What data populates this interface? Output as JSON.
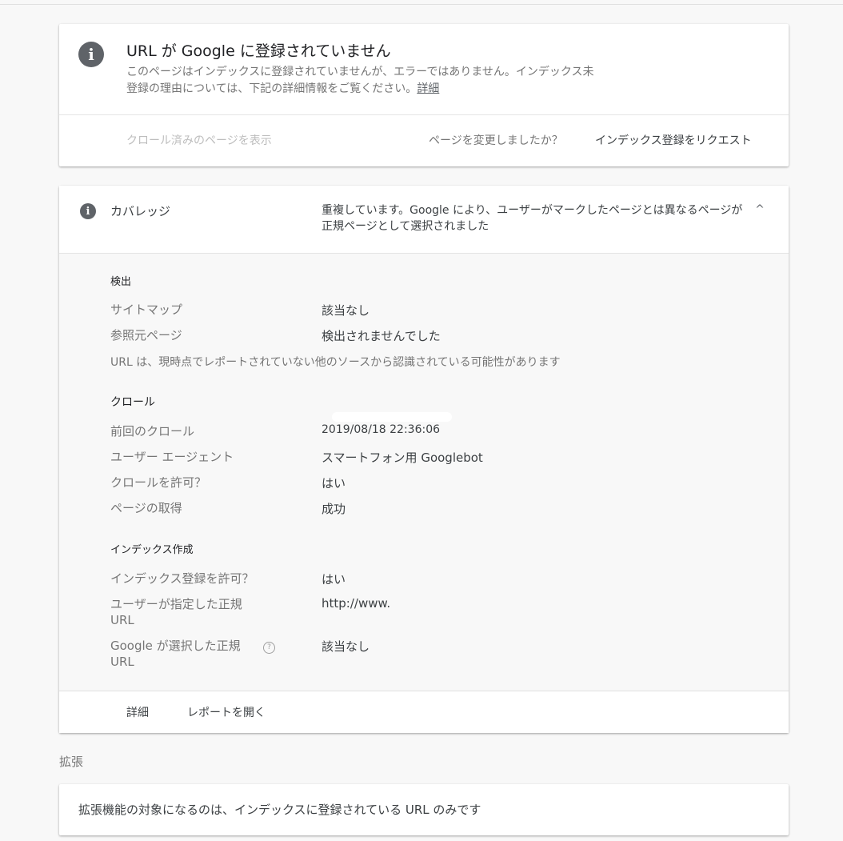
{
  "status_card": {
    "title": "URL が Google に登録されていません",
    "description": "このページはインデックスに登録されていませんが、エラーではありません。インデックス未登録の理由については、下記の詳細情報をご覧ください。",
    "details_link": "詳細",
    "crawled_page_link": "クロール済みのページを表示",
    "page_changed_question": "ページを変更しましたか？",
    "request_indexing_button": "インデックス登録をリクエスト"
  },
  "coverage": {
    "label": "カバレッジ",
    "status": "重複しています。Google により、ユーザーがマークしたページとは異なるページが正規ページとして選択されました",
    "discovery": {
      "heading": "検出",
      "sitemaps_label": "サイトマップ",
      "sitemaps_value": "該当なし",
      "referring_label": "参照元ページ",
      "referring_value": "検出されませんでした",
      "note": "URL は、現時点でレポートされていない他のソースから認識されている可能性があります"
    },
    "crawl": {
      "heading": "クロール",
      "last_crawl_label": "前回のクロール",
      "last_crawl_value": "2019/08/18 22:36:06",
      "user_agent_label": "ユーザー エージェント",
      "user_agent_value": "スマートフォン用 Googlebot",
      "crawl_allowed_label": "クロールを許可？",
      "crawl_allowed_value": "はい",
      "page_fetch_label": "ページの取得",
      "page_fetch_value": "成功"
    },
    "indexing": {
      "heading": "インデックス作成",
      "indexing_allowed_label": "インデックス登録を許可？",
      "indexing_allowed_value": "はい",
      "user_canonical_label": "ユーザーが指定した正規 URL",
      "user_canonical_value": "http://www.",
      "google_canonical_label": "Google が選択した正規 URL",
      "google_canonical_value": "該当なし",
      "help_icon_glyph": "?"
    },
    "footer": {
      "details_button": "詳細",
      "open_report_button": "レポートを開く"
    },
    "chevron_glyph": "^"
  },
  "enhancements": {
    "heading": "拡張",
    "message": "拡張機能の対象になるのは、インデックスに登録されている URL のみです"
  },
  "icons": {
    "info_glyph": "i"
  }
}
